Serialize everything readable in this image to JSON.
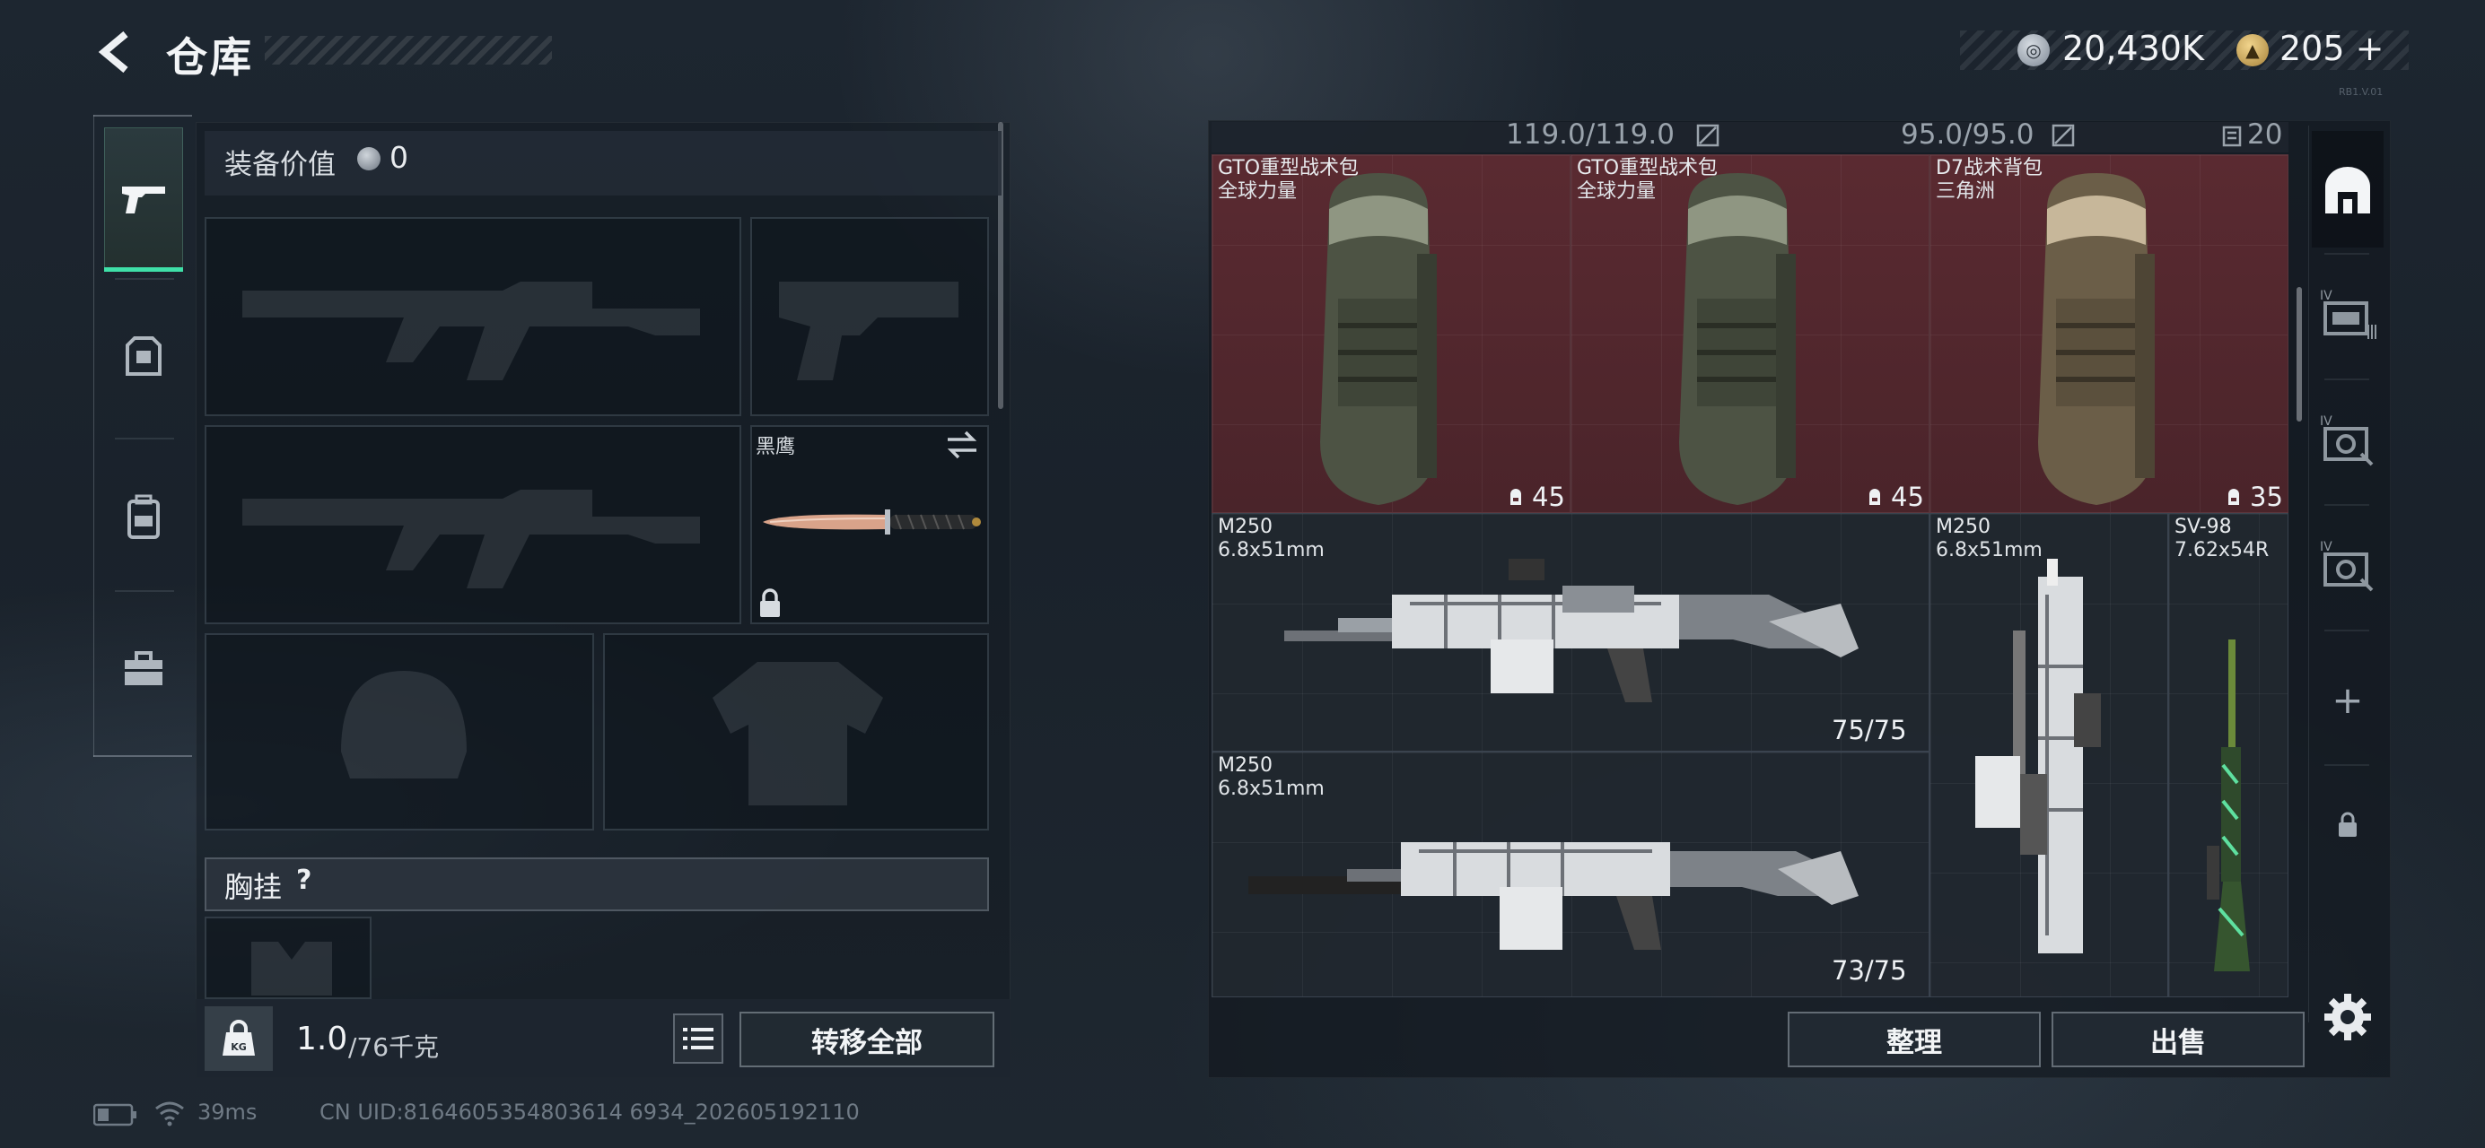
{
  "header": {
    "title": "仓库",
    "currency": {
      "coin_value": "20,430K",
      "coin_icon": "coin-icon",
      "tri_value": "205",
      "tri_plus": "+",
      "tri_icon": "triangle-coin-icon"
    },
    "version_text": "RB1.V.01"
  },
  "categories": [
    {
      "name": "weapons",
      "icon": "pistol-icon",
      "active": true
    },
    {
      "name": "armor",
      "icon": "armor-icon",
      "active": false
    },
    {
      "name": "backpack",
      "icon": "backpack-icon",
      "active": false
    },
    {
      "name": "tools",
      "icon": "toolbox-icon",
      "active": false
    }
  ],
  "equipment": {
    "value_label": "装备价值",
    "value": "0",
    "melee_name": "黑鹰",
    "chest_label": "胸挂",
    "chest_help": "?",
    "weight_current": "1.0",
    "weight_max": "/76千克",
    "transfer_all": "转移全部"
  },
  "storage": {
    "header": {
      "capacity_a": "119.0/119.0",
      "capacity_b": "95.0/95.0",
      "count": "20"
    },
    "items": [
      {
        "name": "GTO重型战术包",
        "sub": "全球力量",
        "count": "45"
      },
      {
        "name": "GTO重型战术包",
        "sub": "全球力量",
        "count": "45"
      },
      {
        "name": "D7战术背包",
        "sub": "三角洲",
        "count": "35"
      },
      {
        "name": "M250",
        "sub": "6.8x51mm",
        "count": "75/75"
      },
      {
        "name": "M250",
        "sub": "6.8x51mm",
        "count": "73/75"
      },
      {
        "name": "M250",
        "sub": "6.8x51mm",
        "count": ""
      },
      {
        "name": "SV-98",
        "sub": "7.62x54R",
        "count": ""
      }
    ],
    "side_tabs": [
      "stash-home-icon",
      "tier4-case-icon",
      "tier4-case-icon",
      "tier4-case-icon",
      "plus-icon",
      "lock-icon"
    ],
    "side_tab_tier": "IV",
    "add_symbol": "+",
    "sort_label": "整理",
    "sell_label": "出售"
  },
  "status_bar": {
    "ping": "39ms",
    "uid": "CN UID:8164605354803614 6934_202605192110"
  },
  "colors": {
    "accent": "#3fe0a8",
    "cell_red": "#5a2a31",
    "panel": "#1a222b"
  }
}
